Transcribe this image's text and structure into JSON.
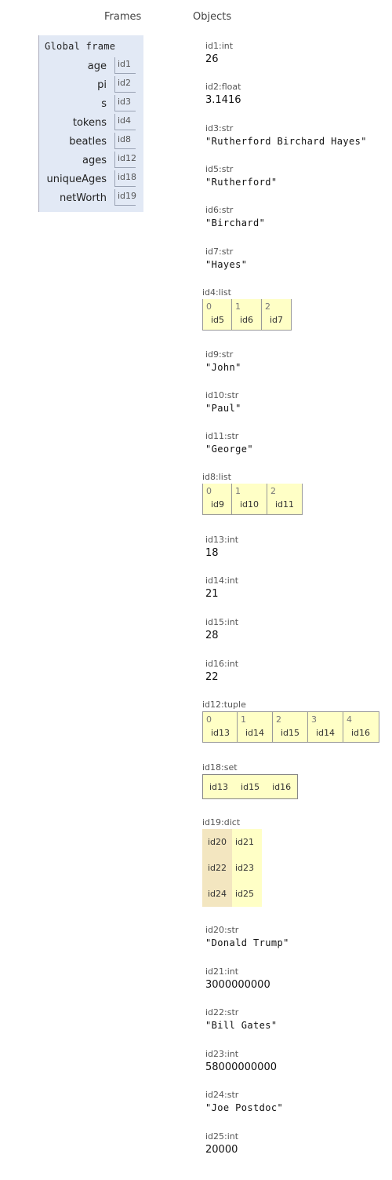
{
  "headers": {
    "frames": "Frames",
    "objects": "Objects"
  },
  "frame": {
    "title": "Global frame",
    "vars": [
      {
        "name": "age",
        "ref": "id1"
      },
      {
        "name": "pi",
        "ref": "id2"
      },
      {
        "name": "s",
        "ref": "id3"
      },
      {
        "name": "tokens",
        "ref": "id4"
      },
      {
        "name": "beatles",
        "ref": "id8"
      },
      {
        "name": "ages",
        "ref": "id12"
      },
      {
        "name": "uniqueAges",
        "ref": "id18"
      },
      {
        "name": "netWorth",
        "ref": "id19"
      }
    ]
  },
  "objects": {
    "id1": {
      "type": "id1:int",
      "value": "26"
    },
    "id2": {
      "type": "id2:float",
      "value": "3.1416"
    },
    "id3": {
      "type": "id3:str",
      "value": "\"Rutherford Birchard Hayes\""
    },
    "id5": {
      "type": "id5:str",
      "value": "\"Rutherford\""
    },
    "id6": {
      "type": "id6:str",
      "value": "\"Birchard\""
    },
    "id7": {
      "type": "id7:str",
      "value": "\"Hayes\""
    },
    "id4": {
      "type": "id4:list",
      "items": [
        {
          "idx": "0",
          "ref": "id5"
        },
        {
          "idx": "1",
          "ref": "id6"
        },
        {
          "idx": "2",
          "ref": "id7"
        }
      ]
    },
    "id9": {
      "type": "id9:str",
      "value": "\"John\""
    },
    "id10": {
      "type": "id10:str",
      "value": "\"Paul\""
    },
    "id11": {
      "type": "id11:str",
      "value": "\"George\""
    },
    "id8": {
      "type": "id8:list",
      "items": [
        {
          "idx": "0",
          "ref": "id9"
        },
        {
          "idx": "1",
          "ref": "id10"
        },
        {
          "idx": "2",
          "ref": "id11"
        }
      ]
    },
    "id13": {
      "type": "id13:int",
      "value": "18"
    },
    "id14": {
      "type": "id14:int",
      "value": "21"
    },
    "id15": {
      "type": "id15:int",
      "value": "28"
    },
    "id16": {
      "type": "id16:int",
      "value": "22"
    },
    "id12": {
      "type": "id12:tuple",
      "items": [
        {
          "idx": "0",
          "ref": "id13"
        },
        {
          "idx": "1",
          "ref": "id14"
        },
        {
          "idx": "2",
          "ref": "id15"
        },
        {
          "idx": "3",
          "ref": "id14"
        },
        {
          "idx": "4",
          "ref": "id16"
        }
      ]
    },
    "id18": {
      "type": "id18:set",
      "items": [
        "id13",
        "id15",
        "id16"
      ]
    },
    "id19": {
      "type": "id19:dict",
      "rows": [
        {
          "key": "id20",
          "val": "id21"
        },
        {
          "key": "id22",
          "val": "id23"
        },
        {
          "key": "id24",
          "val": "id25"
        }
      ]
    },
    "id20": {
      "type": "id20:str",
      "value": "\"Donald Trump\""
    },
    "id21": {
      "type": "id21:int",
      "value": "3000000000"
    },
    "id22": {
      "type": "id22:str",
      "value": "\"Bill Gates\""
    },
    "id23": {
      "type": "id23:int",
      "value": "58000000000"
    },
    "id24": {
      "type": "id24:str",
      "value": "\"Joe Postdoc\""
    },
    "id25": {
      "type": "id25:int",
      "value": "20000"
    }
  }
}
